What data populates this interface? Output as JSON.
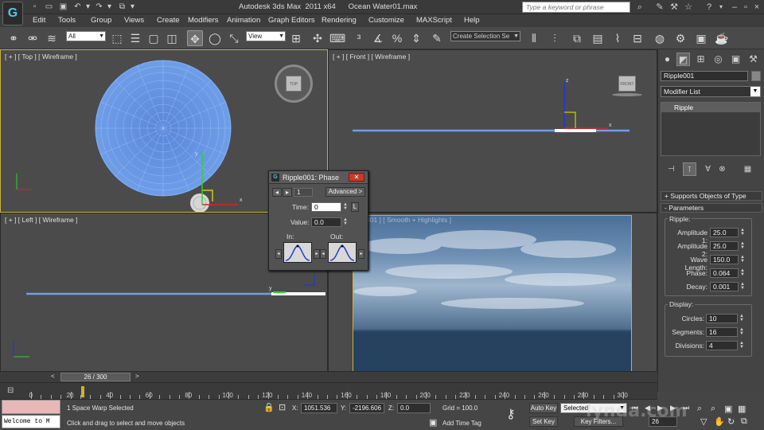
{
  "app": {
    "logo": "G",
    "title": "Autodesk 3ds Max  2011 x64      Ocean Water01.max",
    "search_placeholder": "Type a keyword or phrase"
  },
  "menu": [
    "Edit",
    "Tools",
    "Group",
    "Views",
    "Create",
    "Modifiers",
    "Animation",
    "Graph Editors",
    "Rendering",
    "Customize",
    "MAXScript",
    "Help"
  ],
  "toolbar": {
    "filter": "All",
    "ref_coord": "View",
    "selection_set": "Create Selection Se"
  },
  "viewports": {
    "top": "[ + ] [ Top ] [ Wireframe ]",
    "front": "[ + ] [ Front ] [ Wireframe ]",
    "left": "[ + ] [ Left ] [ Wireframe ]",
    "persp": "001 ] [ Smooth + Highlights ]",
    "cube_top": "TOP",
    "cube_front": "FRONT"
  },
  "dialog": {
    "title": "Ripple001: Phase",
    "nav_value": "1",
    "advanced": "Advanced >",
    "time_label": "Time:",
    "time_value": "0",
    "L": "L",
    "value_label": "Value:",
    "value_value": "0.0",
    "in_label": "In:",
    "out_label": "Out:"
  },
  "panel": {
    "object_name": "Ripple001",
    "modifier_list": "Modifier List",
    "stack_item": "Ripple",
    "rollout_supports": "+ Supports Objects of Type",
    "rollout_params": "- Parameters",
    "ripple_group": "Ripple:",
    "params": [
      {
        "label": "Amplitude 1:",
        "value": "25.0"
      },
      {
        "label": "Amplitude 2:",
        "value": "25.0"
      },
      {
        "label": "Wave Length:",
        "value": "150.0"
      },
      {
        "label": "Phase:",
        "value": "0.064"
      },
      {
        "label": "Decay:",
        "value": "0.001"
      }
    ],
    "display_group": "Display:",
    "display": [
      {
        "label": "Circles:",
        "value": "10"
      },
      {
        "label": "Segments:",
        "value": "16"
      },
      {
        "label": "Divisions:",
        "value": "4"
      }
    ]
  },
  "timeline": {
    "slider": "26 / 300",
    "ticks": [
      "0",
      "20",
      "40",
      "60",
      "80",
      "100",
      "120",
      "140",
      "160",
      "180",
      "200",
      "220",
      "240",
      "260",
      "280",
      "300"
    ]
  },
  "status": {
    "listener": "Welcome to M",
    "selection": "1 Space Warp Selected",
    "prompt": "Click and drag to select and move objects",
    "x_label": "X:",
    "x": "1051.536",
    "y_label": "Y:",
    "y": "-2196.606",
    "z_label": "Z:",
    "z": "0.0",
    "grid": "Grid = 100.0",
    "add_time_tag": "Add Time Tag",
    "auto_key": "Auto Key",
    "auto_key_mode": "Selected",
    "set_key": "Set Key",
    "key_filters": "Key Filters...",
    "frame": "26",
    "watermark": "lynda.com"
  }
}
